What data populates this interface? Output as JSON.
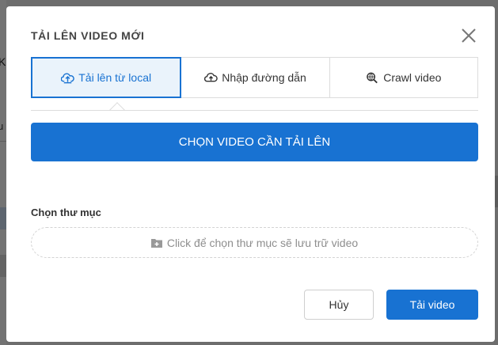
{
  "background": {
    "fragment_k": "K",
    "fragment_u": "u"
  },
  "modal": {
    "title": "TẢI LÊN VIDEO MỚI",
    "tabs": [
      {
        "label": "Tải lên từ local",
        "icon": "cloud-upload-icon",
        "active": true
      },
      {
        "label": "Nhập đường dẫn",
        "icon": "cloud-upload-solid-icon",
        "active": false
      },
      {
        "label": "Crawl video",
        "icon": "search-globe-icon",
        "active": false
      }
    ],
    "select_button": "CHỌN VIDEO CẦN TẢI LÊN",
    "folder": {
      "label": "Chọn thư mục",
      "placeholder": "Click để chọn thư mục sẽ lưu trữ video",
      "icon": "folder-plus-icon"
    },
    "cancel_button": "Hủy",
    "upload_button": "Tải video"
  },
  "colors": {
    "accent": "#1872d2",
    "active_tab_bg": "#eaf3fb"
  }
}
